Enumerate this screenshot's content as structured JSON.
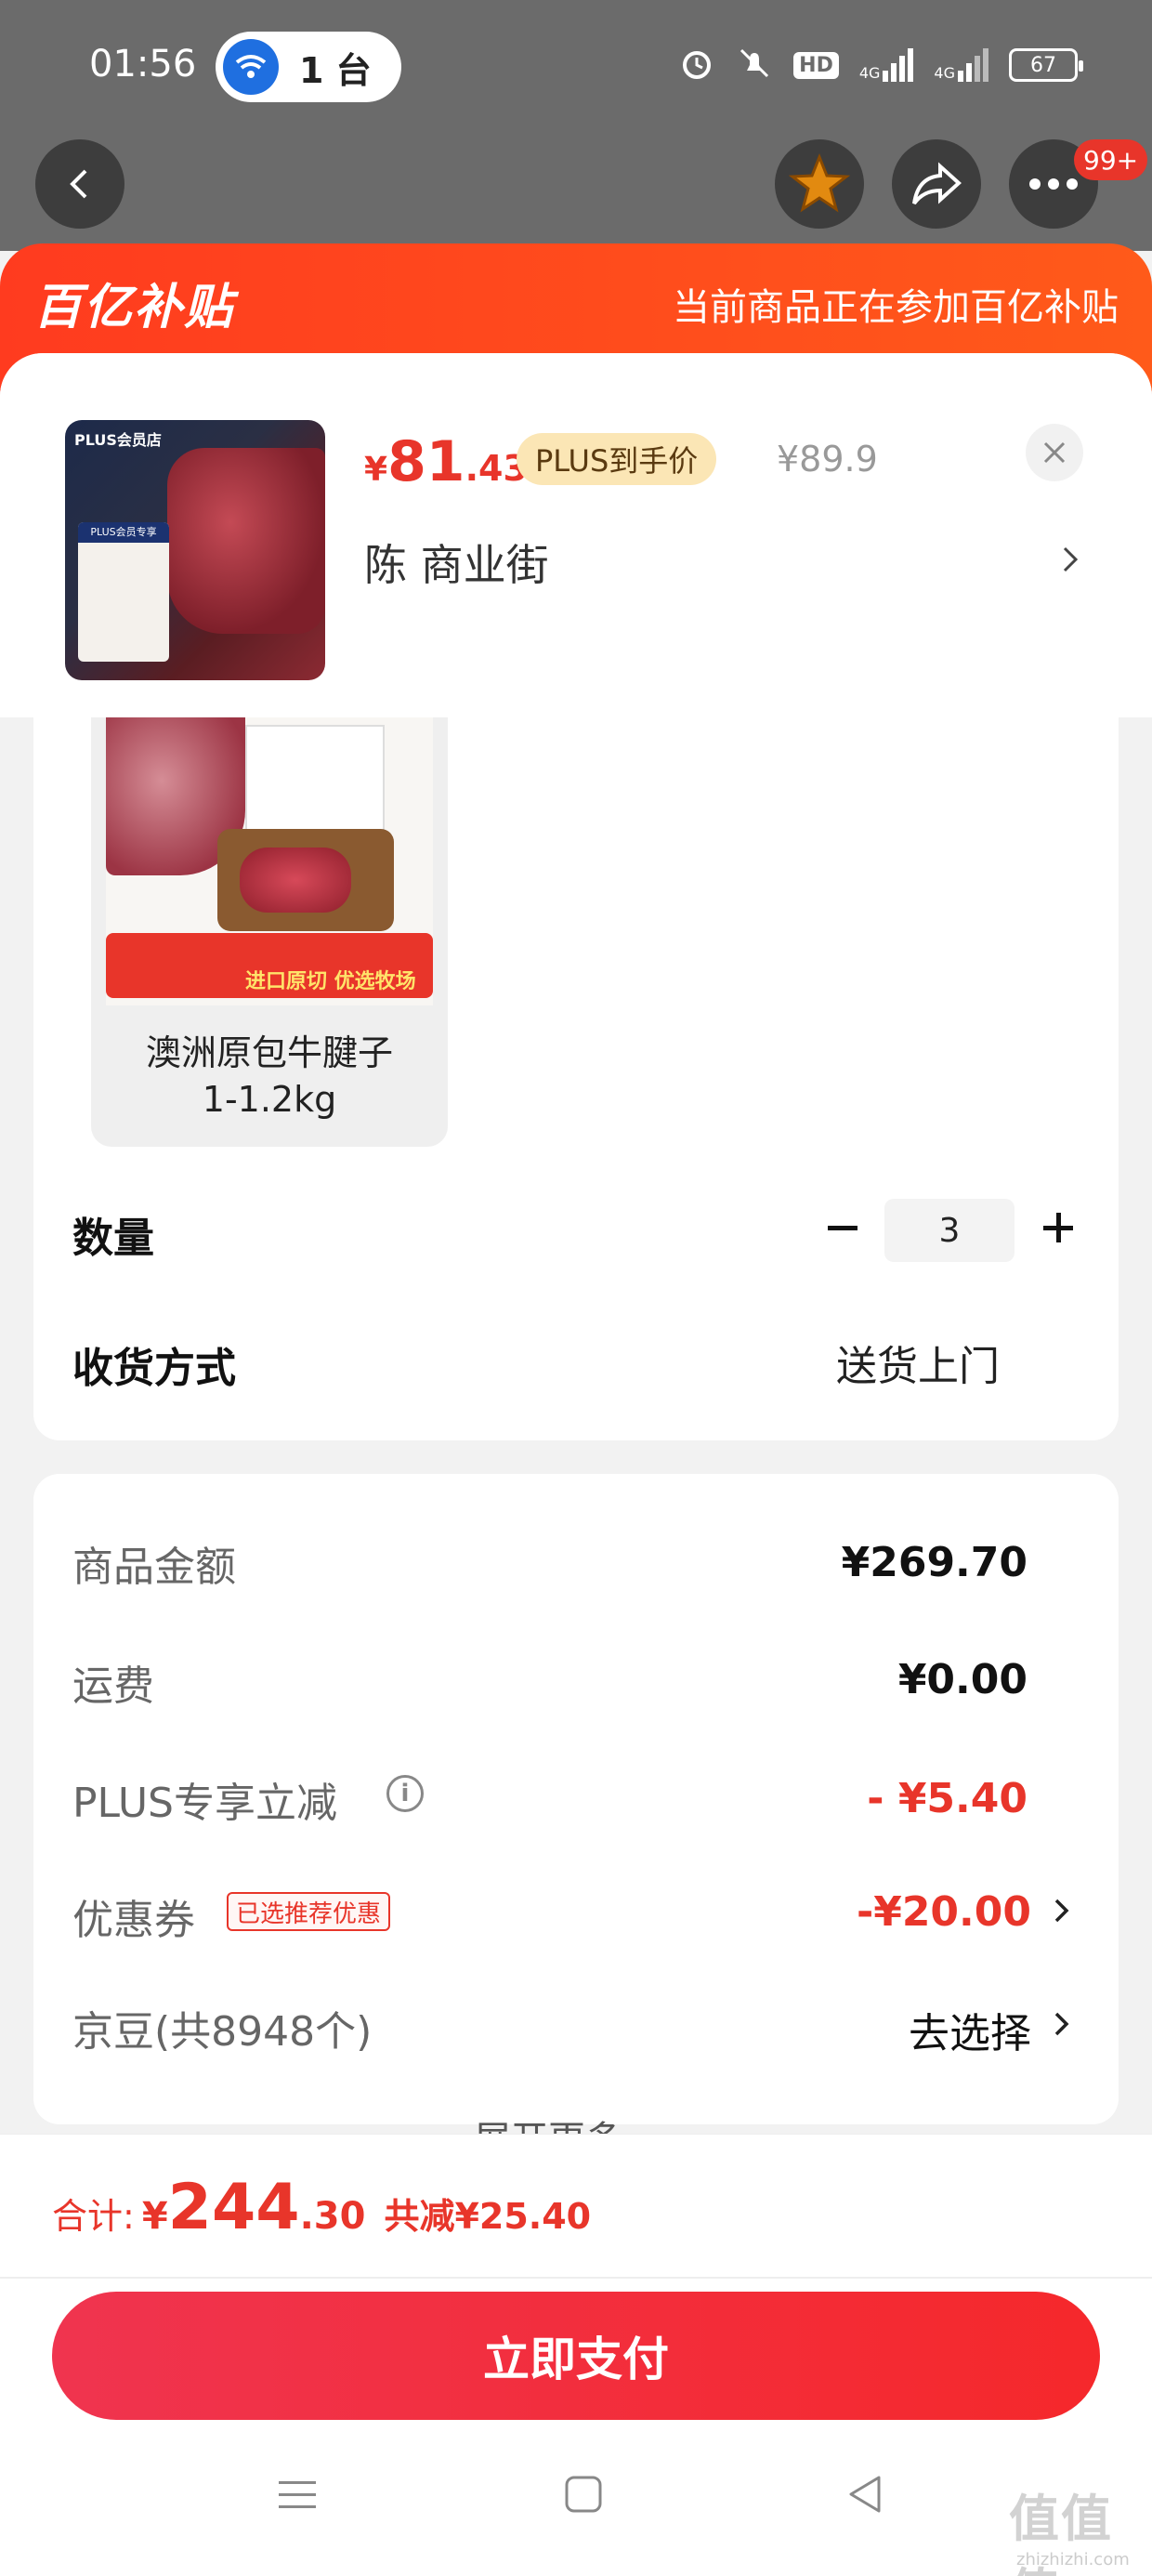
{
  "status_bar": {
    "time": "01:56",
    "hotspot_count": "1 台",
    "network_label": "HD",
    "signal_1": "4G",
    "signal_2": "4G",
    "battery": "67"
  },
  "top_nav": {
    "cart_badge": "99+"
  },
  "banner": {
    "logo": "百亿补贴",
    "text": "当前商品正在参加百亿补贴"
  },
  "product": {
    "thumb_brand": "PLUS会员店",
    "thumb_panel": "PLUS会员专享",
    "price_symbol": "¥",
    "price_int": "81",
    "price_dec": ".43",
    "plus_tag": "PLUS到手价",
    "original_price": "¥89.9",
    "address": "陈  商业街"
  },
  "variant": {
    "image_strip": "进口原切 优选牧场",
    "label": "澳洲原包牛腱子\n1-1.2kg"
  },
  "quantity": {
    "label": "数量",
    "value": "3"
  },
  "delivery": {
    "label": "收货方式",
    "value": "送货上门"
  },
  "breakdown": {
    "goods_label": "商品金额",
    "goods_value": "¥269.70",
    "shipping_label": "运费",
    "shipping_value": "¥0.00",
    "plus_label": "PLUS专享立减",
    "plus_value": "- ¥5.40",
    "coupon_label": "优惠券",
    "coupon_tag": "已选推荐优惠",
    "coupon_value": "-¥20.00",
    "jingdou_label": "京豆(共8948个)",
    "jingdou_value": "去选择",
    "expand_more": "展开更多"
  },
  "summary": {
    "total_label": "合计:",
    "total_symbol": "¥",
    "total_int": "244",
    "total_dec": ".30",
    "total_saved": "共减¥25.40",
    "pay_button": "立即支付"
  },
  "watermark": {
    "text": "值值值",
    "sub": "zhizhizhi.com"
  },
  "colors": {
    "accent_red": "#e8352a",
    "banner_orange": "#ff4a1d",
    "plus_gold": "#fbe6b5"
  }
}
